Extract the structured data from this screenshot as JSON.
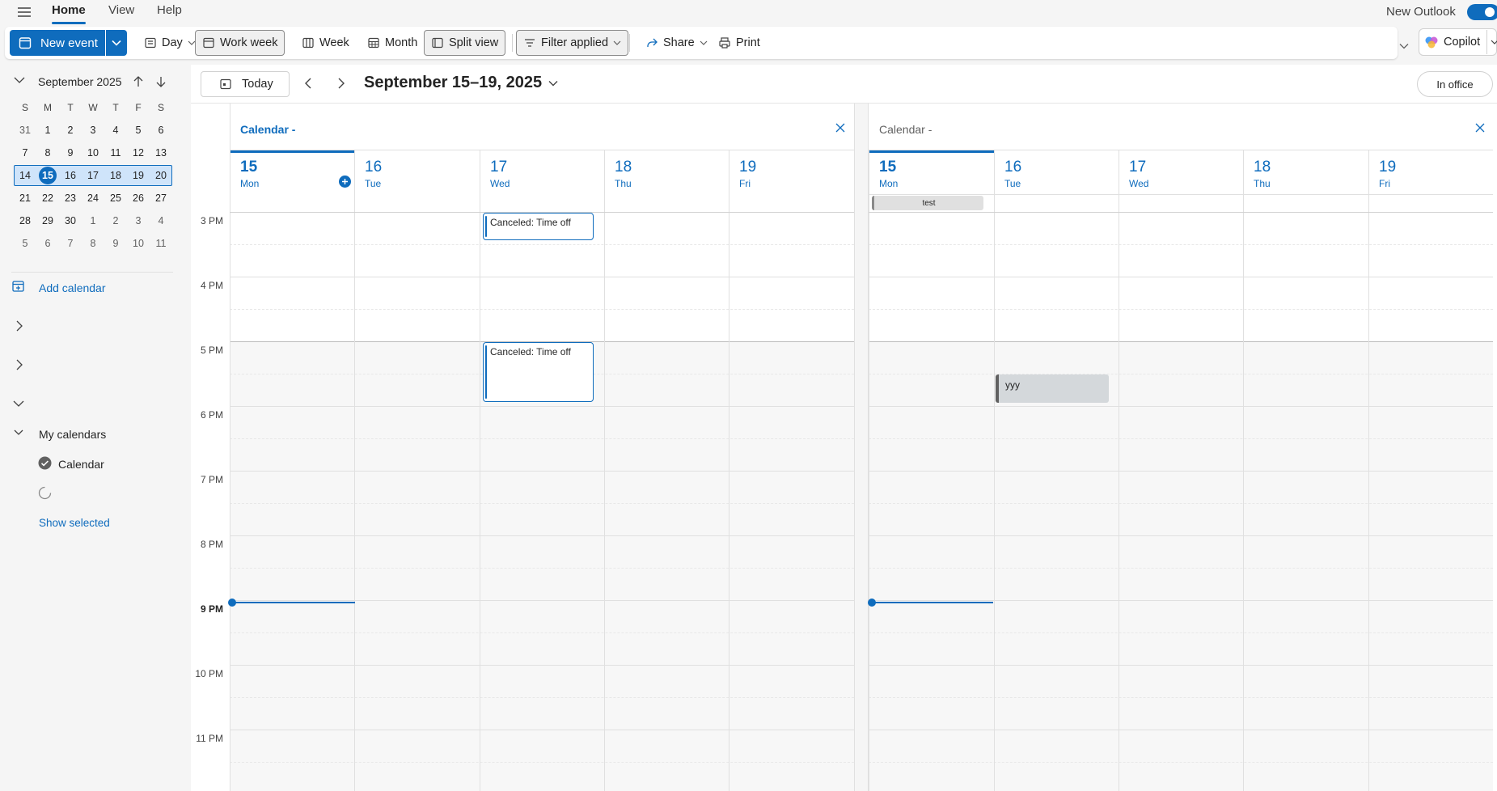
{
  "menu": {
    "tabs": [
      "Home",
      "View",
      "Help"
    ],
    "new_outlook_label": "New Outlook"
  },
  "ribbon": {
    "new_event": "New event",
    "day": "Day",
    "work_week": "Work week",
    "week": "Week",
    "month": "Month",
    "split_view": "Split view",
    "filter": "Filter applied",
    "share": "Share",
    "print": "Print",
    "copilot": "Copilot"
  },
  "mini_calendar": {
    "title": "September 2025",
    "weekday_headers": [
      "S",
      "M",
      "T",
      "W",
      "T",
      "F",
      "S"
    ],
    "weeks": [
      [
        "31",
        "1",
        "2",
        "3",
        "4",
        "5",
        "6"
      ],
      [
        "7",
        "8",
        "9",
        "10",
        "11",
        "12",
        "13"
      ],
      [
        "14",
        "15",
        "16",
        "17",
        "18",
        "19",
        "20"
      ],
      [
        "21",
        "22",
        "23",
        "24",
        "25",
        "26",
        "27"
      ],
      [
        "28",
        "29",
        "30",
        "1",
        "2",
        "3",
        "4"
      ],
      [
        "5",
        "6",
        "7",
        "8",
        "9",
        "10",
        "11"
      ]
    ],
    "today": "15"
  },
  "sidebar": {
    "add_calendar": "Add calendar",
    "my_calendars": "My calendars",
    "calendar_item": "Calendar",
    "show_selected": "Show selected"
  },
  "toolbar": {
    "today": "Today",
    "range": "September 15–19, 2025",
    "status": "In office"
  },
  "panels": [
    {
      "title": "Calendar -",
      "days": [
        {
          "num": "15",
          "name": "Mon"
        },
        {
          "num": "16",
          "name": "Tue"
        },
        {
          "num": "17",
          "name": "Wed"
        },
        {
          "num": "18",
          "name": "Thu"
        },
        {
          "num": "19",
          "name": "Fri"
        }
      ],
      "events": [
        {
          "title": "Canceled: Time off"
        },
        {
          "title": "Canceled: Time off"
        }
      ]
    },
    {
      "title": "Calendar -",
      "days": [
        {
          "num": "15",
          "name": "Mon"
        },
        {
          "num": "16",
          "name": "Tue"
        },
        {
          "num": "17",
          "name": "Wed"
        },
        {
          "num": "18",
          "name": "Thu"
        },
        {
          "num": "19",
          "name": "Fri"
        }
      ],
      "allday_event": "test",
      "events": [
        {
          "title": "yyy"
        }
      ]
    }
  ],
  "hours": [
    "3 PM",
    "4 PM",
    "5 PM",
    "6 PM",
    "7 PM",
    "8 PM",
    "9 PM",
    "10 PM",
    "11 PM"
  ],
  "colors": {
    "accent": "#0f6cbd",
    "busy_event": "#d4d8db",
    "busy_bar": "#616161"
  }
}
